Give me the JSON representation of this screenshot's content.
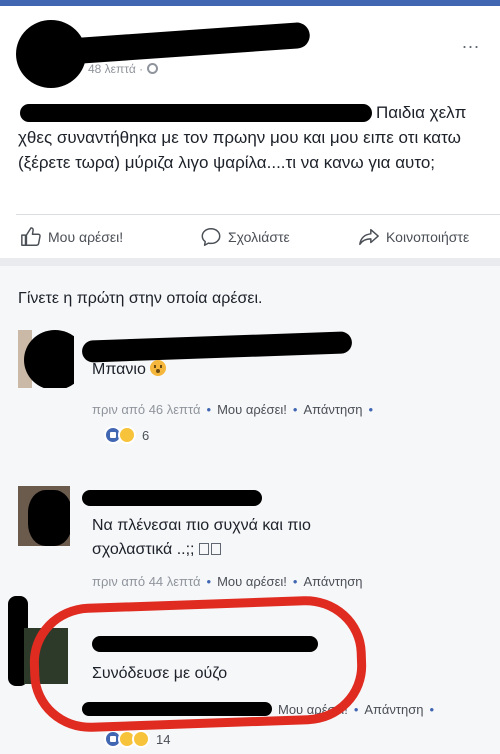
{
  "post": {
    "time": "48 λεπτά",
    "privacy_icon": "globe-icon",
    "text_tail": "Παιδια χελπ",
    "text_body": "χθες συναντήθηκα με τον πρωην μου και μου ειπε οτι κατω (ξέρετε τωρα) μύριζα λιγο ψαρίλα....τι να κανω για αυτο;",
    "more_label": "..."
  },
  "actions": {
    "like": "Μου αρέσει!",
    "comment": "Σχολιάστε",
    "share": "Κοινοποιήστε"
  },
  "first_like": "Γίνετε η πρώτη στην οποία αρέσει.",
  "comments": [
    {
      "text": "Μπανιο",
      "time": "πριν από 46 λεπτά",
      "like": "Μου αρέσει!",
      "reply": "Απάντηση",
      "reaction_count": "6"
    },
    {
      "text": "Να πλένεσαι πιο συχνά και πιο σχολαστικά ..;; ",
      "time": "πριν από 44 λεπτά",
      "like": "Μου αρέσει!",
      "reply": "Απάντηση"
    },
    {
      "text": "Συνόδευσε με ούζο",
      "like": "Μου αρέσει!",
      "reply": "Απάντηση",
      "reaction_count": "14"
    }
  ],
  "colors": {
    "accent": "#4267b2",
    "highlight_circle": "#e02b20"
  }
}
